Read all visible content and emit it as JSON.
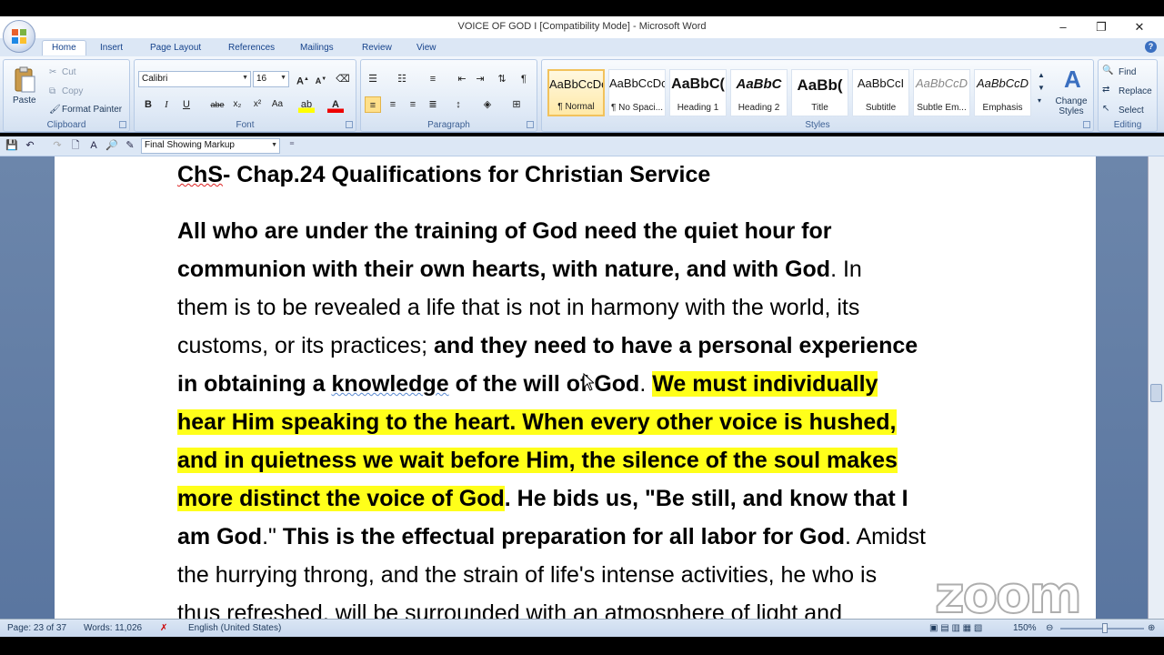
{
  "window": {
    "title": "VOICE OF GOD I [Compatibility Mode] - Microsoft Word",
    "minimize": "–",
    "restore": "❐",
    "close": "✕"
  },
  "tabs": [
    "Home",
    "Insert",
    "Page Layout",
    "References",
    "Mailings",
    "Review",
    "View"
  ],
  "ribbon": {
    "clipboard": {
      "label": "Clipboard",
      "paste": "Paste",
      "cut": "Cut",
      "copy": "Copy",
      "format_painter": "Format Painter"
    },
    "font": {
      "label": "Font",
      "font_name": "Calibri",
      "font_size": "16"
    },
    "paragraph": {
      "label": "Paragraph"
    },
    "styles": {
      "label": "Styles",
      "items": [
        {
          "preview": "AaBbCcDc",
          "name": "¶ Normal"
        },
        {
          "preview": "AaBbCcDc",
          "name": "¶ No Spaci..."
        },
        {
          "preview": "AaBbC(",
          "name": "Heading 1"
        },
        {
          "preview": "AaBbC",
          "name": "Heading 2"
        },
        {
          "preview": "AaBb(",
          "name": "Title"
        },
        {
          "preview": "AaBbCcI",
          "name": "Subtitle"
        },
        {
          "preview": "AaBbCcD",
          "name": "Subtle Em..."
        },
        {
          "preview": "AaBbCcD",
          "name": "Emphasis"
        }
      ],
      "change_styles": "Change Styles"
    },
    "editing": {
      "label": "Editing",
      "find": "Find",
      "replace": "Replace",
      "select": "Select"
    }
  },
  "qat": {
    "markup": "Final Showing Markup"
  },
  "document": {
    "heading_prefix": "ChS",
    "heading_rest": "- Chap.24 Qualifications for Christian Service",
    "lines": [
      [
        {
          "t": "All who are under the training of God need the quiet hour for",
          "s": "b"
        }
      ],
      [
        {
          "t": "communion with their own hearts, with nature, and with God",
          "s": "b"
        },
        {
          "t": ". In",
          "s": ""
        }
      ],
      [
        {
          "t": "them is to be revealed a life that is not in harmony with the world, its",
          "s": ""
        }
      ],
      [
        {
          "t": "customs, or its practices; ",
          "s": ""
        },
        {
          "t": "and they need to have a personal experience",
          "s": "b"
        }
      ],
      [
        {
          "t": "in obtaining a ",
          "s": "b"
        },
        {
          "t": "knowledge",
          "s": "b wavy"
        },
        {
          "t": " of the will of God",
          "s": "b"
        },
        {
          "t": ". ",
          "s": ""
        },
        {
          "t": "We must individually",
          "s": "b hl"
        }
      ],
      [
        {
          "t": "hear Him speaking to the heart. When every other voice is hushed,",
          "s": "b hl"
        }
      ],
      [
        {
          "t": "and in quietness we wait before Him, the silence of the soul makes",
          "s": "b hl"
        }
      ],
      [
        {
          "t": "more distinct the voice of God",
          "s": "b hl"
        },
        {
          "t": ". He bids us, \"Be still, and know that I",
          "s": "b"
        }
      ],
      [
        {
          "t": "am God",
          "s": "b"
        },
        {
          "t": ".\" ",
          "s": ""
        },
        {
          "t": "This is the effectual preparation for all labor for God",
          "s": "b"
        },
        {
          "t": ". Amidst",
          "s": ""
        }
      ],
      [
        {
          "t": "the hurrying throng, and the strain of life's intense activities, he who is",
          "s": ""
        }
      ],
      [
        {
          "t": "thus refreshed, will be surrounded with an atmosphere of light and",
          "s": ""
        }
      ]
    ]
  },
  "status": {
    "page": "Page: 23 of 37",
    "words": "Words: 11,026",
    "language": "English (United States)",
    "zoom": "150%"
  },
  "watermark": "zoom"
}
